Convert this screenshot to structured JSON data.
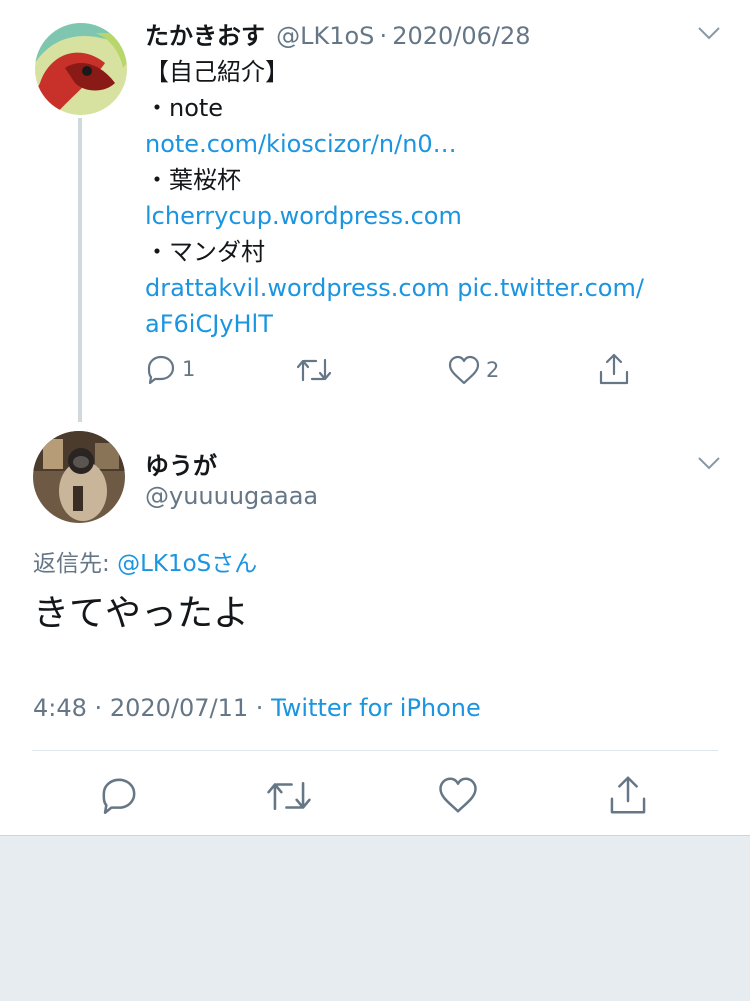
{
  "tweet1": {
    "display_name": "たかきおす",
    "handle": "@LK1oS",
    "sep": "·",
    "date": "2020/06/28",
    "lines": [
      {
        "text": "【自己紹介】",
        "type": "text"
      },
      {
        "text": "・note",
        "type": "text"
      },
      {
        "text": "note.com/kioscizor/n/n0…",
        "type": "link"
      },
      {
        "text": "・葉桜杯",
        "type": "text"
      },
      {
        "text": "lcherrycup.wordpress.com",
        "type": "link"
      },
      {
        "text": "・マンダ村",
        "type": "text"
      },
      {
        "text": "drattakvil.wordpress.com pic.twitter.com/",
        "type": "link"
      },
      {
        "text": "aF6iCJyHlT",
        "type": "link"
      }
    ],
    "reply_count": "1",
    "like_count": "2"
  },
  "tweet2": {
    "display_name": "ゆうが",
    "handle": "@yuuuugaaaa",
    "reply_to_label": "返信先:",
    "reply_to_handle": "@LK1oSさん",
    "body": "きてやったよ",
    "time": "4:48",
    "date": "2020/07/11",
    "sep": "·",
    "source": "Twitter for iPhone"
  },
  "colors": {
    "link": "#1b95e0",
    "muted": "#657786",
    "thread_line": "#cfd9de",
    "footer_bg": "#e6ecf0"
  },
  "icons": [
    "reply-icon",
    "retweet-icon",
    "like-icon",
    "share-icon",
    "chevron-down-icon"
  ]
}
